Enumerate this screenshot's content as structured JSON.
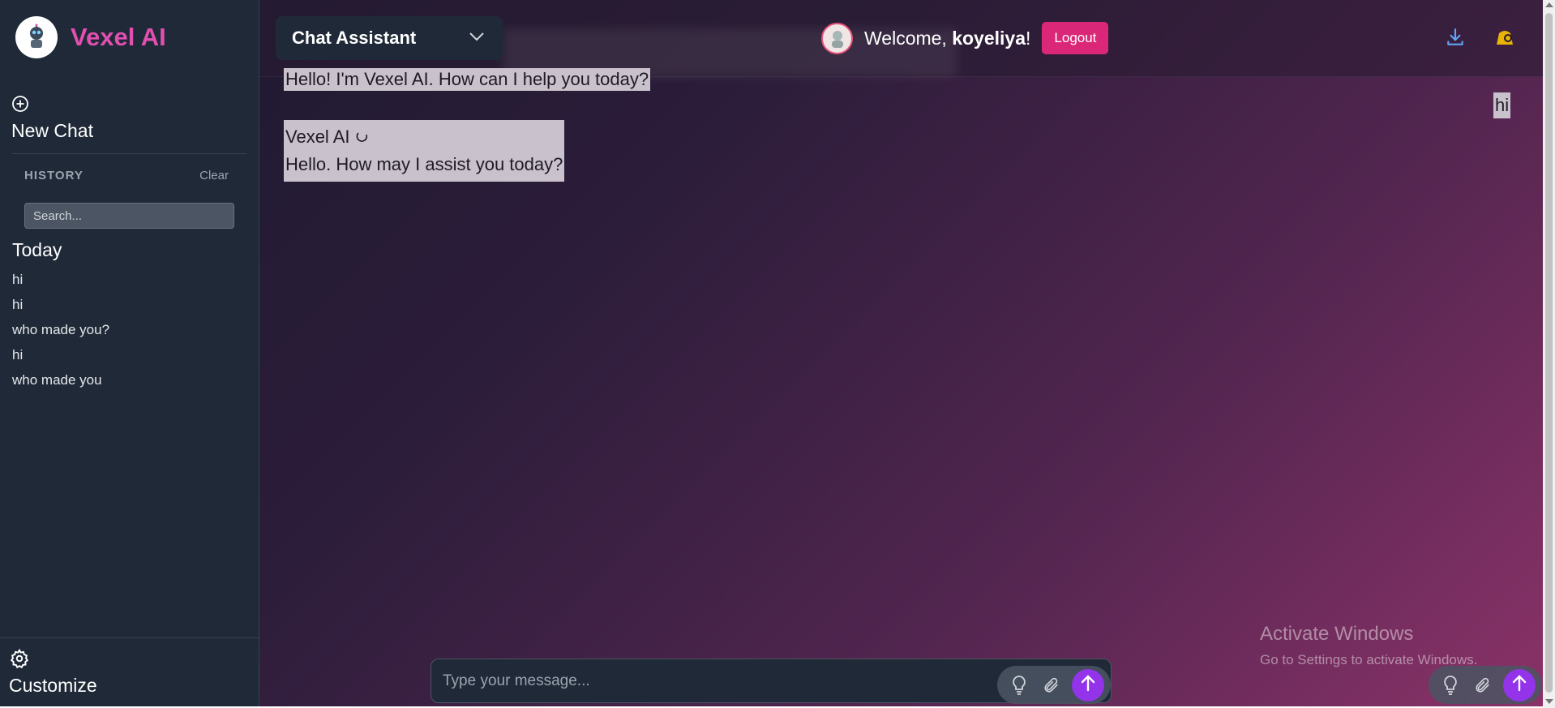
{
  "app": {
    "name": "Vexel AI",
    "brand_color": "#e14fb0"
  },
  "sidebar": {
    "new_chat_label": "New Chat",
    "history_title": "HISTORY",
    "clear_label": "Clear",
    "search_placeholder": "Search...",
    "group_label": "Today",
    "items": [
      {
        "label": "hi"
      },
      {
        "label": "hi"
      },
      {
        "label": "who made you?"
      },
      {
        "label": "hi"
      },
      {
        "label": "who made you"
      }
    ],
    "customize_label": "Customize"
  },
  "header": {
    "model_label": "Chat Assistant",
    "welcome_prefix": "Welcome, ",
    "username": "koyeliya",
    "welcome_suffix": "!",
    "logout_label": "Logout"
  },
  "messages": {
    "bot_intro": "Hello! I'm Vexel AI. How can I help you today?",
    "user_message": "hi",
    "bot_name": "Vexel AI",
    "bot_reply": "Hello. How may I assist you today?"
  },
  "composer": {
    "placeholder": "Type your message..."
  },
  "watermark": {
    "line1": "Activate Windows",
    "line2": "Go to Settings to activate Windows."
  },
  "icons": {
    "new_chat": "plus-circle-icon",
    "customize": "gear-icon",
    "download": "download-icon",
    "theme": "theme-toggle-icon",
    "idea": "lightbulb-icon",
    "attach": "paperclip-icon",
    "send": "arrow-up-icon"
  },
  "colors": {
    "sidebar_bg": "#1f2937",
    "logout_bg": "#db2777",
    "send_bg": "#9333ea"
  }
}
